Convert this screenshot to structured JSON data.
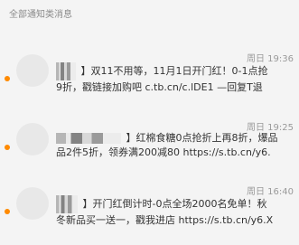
{
  "header": {
    "title": "全部通知类消息"
  },
  "notifications": [
    {
      "time": "周日 19:36",
      "line1": "】双11不用等，11月1日开门红！0-1点抢",
      "line2": "9折，戳链接加购吧 c.tb.cn/c.lDE1 —回复T退"
    },
    {
      "time": "周日 19:25",
      "line1": "】红棉食糖0点抢折上再8折，爆品",
      "line2": "品2件5折，领券满200减80 https://s.tb.cn/y6."
    },
    {
      "time": "周日 16:40",
      "line1": "】开门红倒计时-0点全场2000名免单！秋",
      "line2": "冬新品买一送一，戳我进店 https://s.tb.cn/y6.X"
    }
  ],
  "colors": {
    "unread_dot": "#ff8a00",
    "background": "#f4f4f4"
  }
}
